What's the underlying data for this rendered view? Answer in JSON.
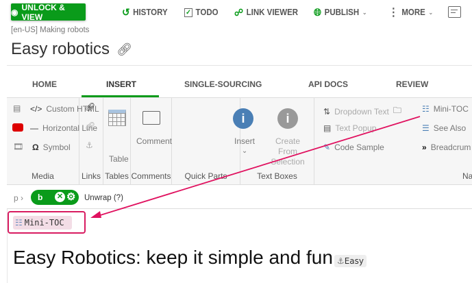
{
  "toolbar": {
    "unlock_label": "UNLOCK & VIEW",
    "history_label": "HISTORY",
    "todo_label": "TODO",
    "link_viewer_label": "LINK VIEWER",
    "publish_label": "PUBLISH",
    "more_label": "MORE"
  },
  "breadcrumb": "[en-US] Making robots",
  "page_title": "Easy robotics",
  "tabs": [
    {
      "label": "HOME"
    },
    {
      "label": "INSERT",
      "active": true
    },
    {
      "label": "SINGLE-SOURCING"
    },
    {
      "label": "API DOCS"
    },
    {
      "label": "REVIEW"
    }
  ],
  "ribbon": {
    "media": {
      "label": "Media",
      "items": [
        "Custom HTML",
        "Horizontal Line",
        "Symbol"
      ]
    },
    "links": {
      "label": "Links"
    },
    "tables": {
      "label": "Tables",
      "table": "Table"
    },
    "comments": {
      "label": "Comments",
      "comment": "Comment"
    },
    "quick_parts": {
      "label": "Quick Parts",
      "insert": "Insert",
      "create_from_selection": "Create From Selection"
    },
    "text_boxes": {
      "label": "Text Boxes",
      "items": [
        "Dropdown Text",
        "Text Popup",
        "Code Sample"
      ]
    },
    "navigation": {
      "label": "Na",
      "items": [
        "Mini-TOC",
        "See Also",
        "Breadcrum"
      ]
    }
  },
  "path_bar": {
    "p": "p",
    "element": "b",
    "unwrap": "Unwrap",
    "help": "(?)"
  },
  "content": {
    "mini_toc": "Mini-TOC",
    "heading": "Easy Robotics: keep it simple and fun",
    "anchor": "Easy"
  },
  "colors": {
    "accent": "#0a9b1a",
    "annotation": "#d81b60"
  }
}
